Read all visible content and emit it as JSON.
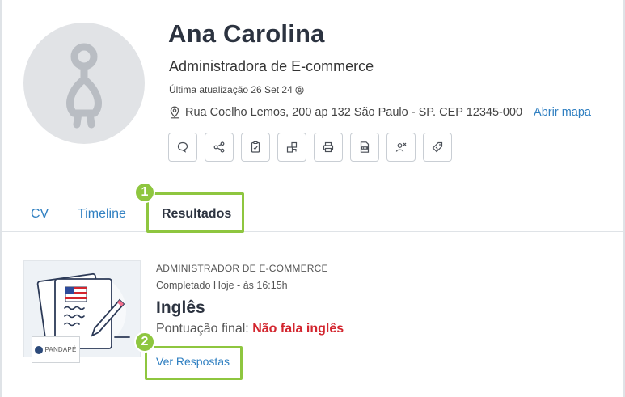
{
  "profile": {
    "name": "Ana Carolina",
    "role": "Administradora de E-commerce",
    "updated": "Última atualização 26 Set 24",
    "address": "Rua Coelho Lemos, 200 ap 132 São Paulo - SP. CEP 12345-000",
    "map_link": "Abrir mapa"
  },
  "actions": [
    {
      "icon": "chat-icon"
    },
    {
      "icon": "share-icon"
    },
    {
      "icon": "clipboard-check-icon"
    },
    {
      "icon": "transfer-icon"
    },
    {
      "icon": "print-icon"
    },
    {
      "icon": "doc-icon"
    },
    {
      "icon": "remove-user-icon"
    },
    {
      "icon": "tag-icon"
    }
  ],
  "tabs": {
    "cv": "CV",
    "timeline": "Timeline",
    "results": "Resultados"
  },
  "markers": {
    "one": "1",
    "two": "2"
  },
  "result": {
    "category": "ADMINISTRADOR DE E-COMMERCE",
    "completed": "Completado Hoje - às 16:15h",
    "title": "Inglês",
    "score_label": "Pontuação final:",
    "score_value": "Não fala inglês",
    "link": "Ver Respostas",
    "brand": "PANDAPÉ"
  },
  "colors": {
    "accent": "#2f7fc1",
    "highlight": "#8ec63f",
    "danger": "#d3262f"
  }
}
